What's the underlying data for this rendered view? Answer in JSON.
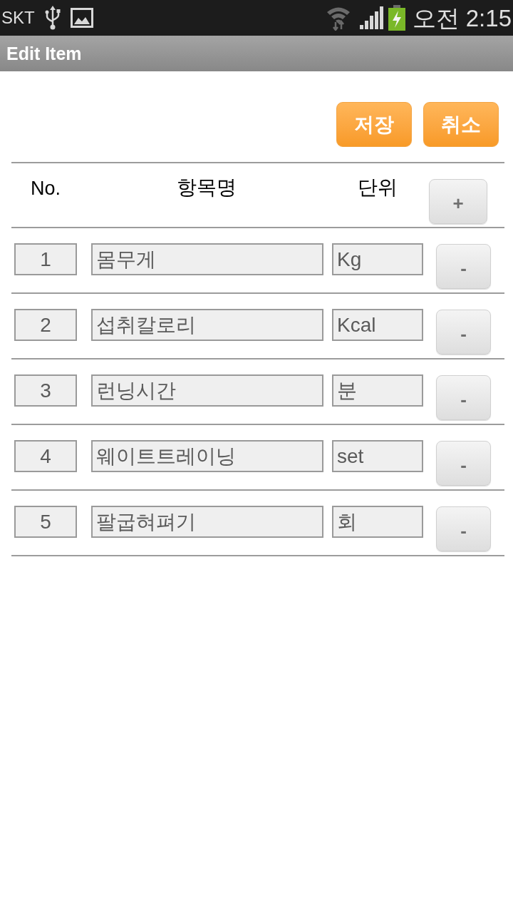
{
  "status_bar": {
    "carrier": "SKT",
    "time": "오전 2:15"
  },
  "title_bar": {
    "title": "Edit Item"
  },
  "actions": [
    {
      "label": "저장"
    },
    {
      "label": "취소"
    }
  ],
  "table": {
    "columns": [
      "No.",
      "항목명",
      "단위"
    ],
    "add_button": "+",
    "rows": [
      {
        "no": "1",
        "name": "몸무게",
        "unit": "Kg",
        "remove_button": "-"
      },
      {
        "no": "2",
        "name": "섭취칼로리",
        "unit": "Kcal",
        "remove_button": "-"
      },
      {
        "no": "3",
        "name": "런닝시간",
        "unit": "분",
        "remove_button": "-"
      },
      {
        "no": "4",
        "name": "웨이트트레이닝",
        "unit": "set",
        "remove_button": "-"
      },
      {
        "no": "5",
        "name": "팔굽혀펴기",
        "unit": "회",
        "remove_button": "-"
      }
    ]
  }
}
